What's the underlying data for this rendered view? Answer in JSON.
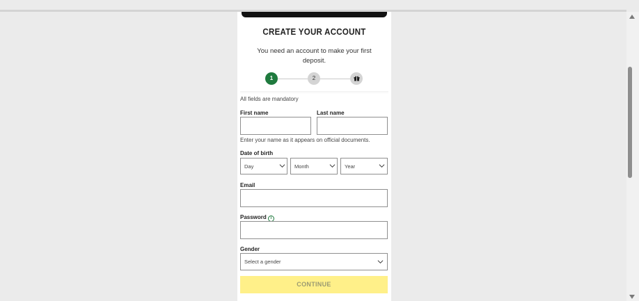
{
  "form": {
    "title": "CREATE YOUR ACCOUNT",
    "subtitle": "You need an account to make your first deposit.",
    "steps": [
      {
        "label": "1",
        "state": "active"
      },
      {
        "label": "2",
        "state": "inactive"
      },
      {
        "label": "",
        "icon": "gift-icon",
        "state": "inactive"
      }
    ],
    "mandatory_note": "All fields are mandatory",
    "first_name_label": "First name",
    "last_name_label": "Last name",
    "first_name_value": "",
    "last_name_value": "",
    "name_hint": "Enter your name as it appears on official documents.",
    "dob_label": "Date of birth",
    "dob_day": "Day",
    "dob_month": "Month",
    "dob_year": "Year",
    "email_label": "Email",
    "email_value": "",
    "password_label": "Password",
    "password_value": "",
    "gender_label": "Gender",
    "gender_value": "Select a gender",
    "continue_label": "CONTINUE"
  },
  "colors": {
    "step_active": "#1f7a3e",
    "continue_bg": "#fff089",
    "page_bg": "#ebebeb"
  }
}
